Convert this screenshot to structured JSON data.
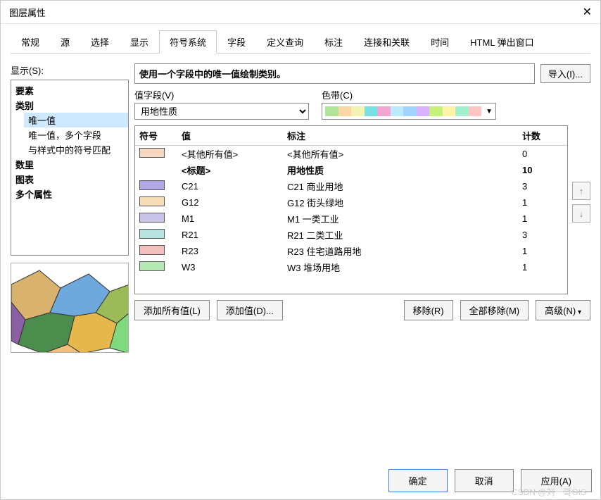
{
  "window": {
    "title": "图层属性",
    "close_icon": "✕"
  },
  "tabs": [
    "常规",
    "源",
    "选择",
    "显示",
    "符号系统",
    "字段",
    "定义查询",
    "标注",
    "连接和关联",
    "时间",
    "HTML 弹出窗口"
  ],
  "active_tab_index": 4,
  "left": {
    "show_label": "显示(S):",
    "tree": {
      "n0": "要素",
      "n1": "类别",
      "n1a": "唯一值",
      "n1b": "唯一值，多个字段",
      "n1c": "与样式中的符号匹配",
      "n2": "数里",
      "n3": "图表",
      "n4": "多个属性"
    }
  },
  "right": {
    "description": "使用一个字段中的唯一值绘制类别。",
    "import_btn": "导入(I)...",
    "value_field_label": "值字段(V)",
    "value_field_selected": "用地性质",
    "color_ramp_label": "色带(C)",
    "ramp_colors": [
      "#b1e39a",
      "#f9d6a3",
      "#f2f2b2",
      "#79e2e0",
      "#f4a6d3",
      "#bde9ff",
      "#a3d3ff",
      "#d9b3ff",
      "#c6f27a",
      "#fff3a6",
      "#a5f0cc",
      "#ffc4c4"
    ]
  },
  "grid": {
    "headers": {
      "symbol": "符号",
      "value": "值",
      "label": "标注",
      "count": "计数"
    },
    "rows": [
      {
        "color": "#f8d7c0",
        "value": "<其他所有值>",
        "label": "<其他所有值>",
        "count": "0",
        "bold": false,
        "show_sym": true
      },
      {
        "color": "",
        "value": "<标题>",
        "label": "用地性质",
        "count": "10",
        "bold": true,
        "show_sym": false
      },
      {
        "color": "#b4a7e5",
        "value": "C21",
        "label": "C21 商业用地",
        "count": "3",
        "bold": false,
        "show_sym": true
      },
      {
        "color": "#f6dcb5",
        "value": "G12",
        "label": "G12 街头绿地",
        "count": "1",
        "bold": false,
        "show_sym": true
      },
      {
        "color": "#c8c5e8",
        "value": "M1",
        "label": "M1 一类工业",
        "count": "1",
        "bold": false,
        "show_sym": true
      },
      {
        "color": "#b7e3e0",
        "value": "R21",
        "label": "R21 二类工业",
        "count": "3",
        "bold": false,
        "show_sym": true
      },
      {
        "color": "#f3c0c0",
        "value": "R23",
        "label": "R23 住宅道路用地",
        "count": "1",
        "bold": false,
        "show_sym": true
      },
      {
        "color": "#b5e8b5",
        "value": "W3",
        "label": "W3 堆场用地",
        "count": "1",
        "bold": false,
        "show_sym": true
      }
    ]
  },
  "buttons": {
    "add_all": "添加所有值(L)",
    "add_val": "添加值(D)...",
    "remove": "移除(R)",
    "remove_all": "全部移除(M)",
    "advanced": "高级(N)"
  },
  "footer": {
    "ok": "确定",
    "cancel": "取消",
    "apply": "应用(A)"
  },
  "watermark": "CSDN @刘一哥GIS",
  "preview_colors": [
    "#d9b36e",
    "#6fa8dc",
    "#9bbb59",
    "#8b5fa3",
    "#4c8c4c",
    "#e6b84c",
    "#7fd97f",
    "#c87070",
    "#f2c079"
  ]
}
